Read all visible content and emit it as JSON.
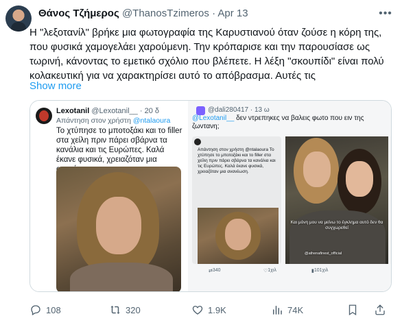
{
  "tweet": {
    "author_name": "Θάνος Τζήμερος",
    "handle": "@ThanosTzimeros",
    "separator": "·",
    "date": "Apr 13",
    "text": "Η \"λεξοτανίλ\" βρήκε μια φωτογραφία της Καρυστιανού όταν ζούσε η κόρη της, που φυσικά χαμογελάει χαρούμενη. Την κρόπαρισε και την παρουσίασε ως τωρινή, κάνοντας το εμετικό σχόλιο που βλέπετε. Η λέξη \"σκουπίδι\" είναι πολύ κολακευτική για να χαρακτηρίσει αυτό το απόβρασμα. Αυτές τις",
    "show_more": "Show more"
  },
  "embedded_left": {
    "name": "Lexotanil",
    "handle": "@Lexotanil__",
    "separator": "·",
    "time": "20 δ",
    "reply_prefix": "Απάντηση στον χρήστη",
    "reply_mention": "@ntalaoura",
    "body": "Το χτύπησε το μποτοξάκι και το filler στα χείλη πριν πάρει σβάρνα τα κανάλια και τις Ευρώπες. Καλά έκανε φυσικά, χρειαζόταν μια ανανέωση."
  },
  "embedded_right": {
    "handle": "@dali280417",
    "separator": "·",
    "time": "13 ω",
    "mention": "@Lexotanil__",
    "body_rest": "δεν ντρεπηκες να βαλεις φωτο που ειν της ζωντανη;",
    "inner_text": "Απάντηση στον χρήστη @ntalaoura Το χτύπησε το μποτοξάκι και το filler στα χείλη πριν πάρει σβάρνα τα κανάλια και τις Ευρώπες. Καλά έκανε φυσικά, χρειαζόταν μια ανανέωση.",
    "photo_caption": "Και μόνη μου να μείνω το έγκλημα αυτό δεν θα συγχωρεθεί",
    "watermark": "@athenafinest_official",
    "retweets": "340",
    "likes": "1χιλ",
    "views": "101χιλ"
  },
  "actions": {
    "replies": "108",
    "reposts": "320",
    "likes": "1.9K",
    "views": "74K"
  },
  "icons": [
    "more-icon",
    "reply-icon",
    "repost-icon",
    "like-icon",
    "views-icon",
    "bookmark-icon",
    "share-icon"
  ]
}
